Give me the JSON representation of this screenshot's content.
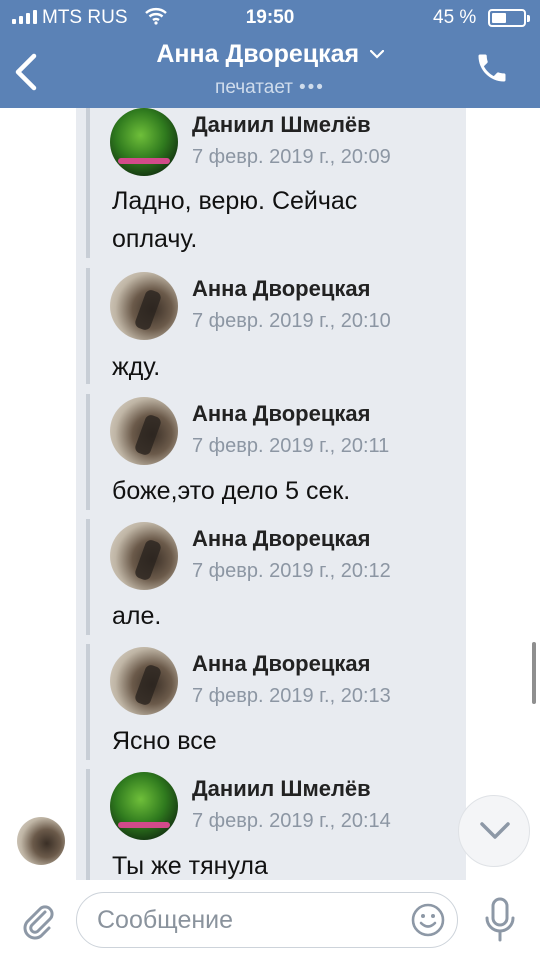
{
  "status_bar": {
    "carrier": "MTS RUS",
    "time": "19:50",
    "battery_percent": "45 %"
  },
  "header": {
    "contact_name": "Анна Дворецкая",
    "status_text": "печатает",
    "typing_dots": "•••"
  },
  "messages": [
    {
      "author": "Даниил Шмелёв",
      "avatar": "daniil",
      "date": "7 февр. 2019 г., 20:09",
      "lines": [
        "Ладно, верю. Сейчас",
        "оплачу."
      ]
    },
    {
      "author": "Анна Дворецкая",
      "avatar": "anna",
      "date": "7 февр. 2019 г., 20:10",
      "lines": [
        "жду."
      ]
    },
    {
      "author": "Анна Дворецкая",
      "avatar": "anna",
      "date": "7 февр. 2019 г., 20:11",
      "lines": [
        "боже,это дело 5 сек."
      ]
    },
    {
      "author": "Анна Дворецкая",
      "avatar": "anna",
      "date": "7 февр. 2019 г., 20:12",
      "lines": [
        "але."
      ]
    },
    {
      "author": "Анна Дворецкая",
      "avatar": "anna",
      "date": "7 февр. 2019 г., 20:13",
      "lines": [
        "Ясно все"
      ]
    },
    {
      "author": "Даниил Шмелёв",
      "avatar": "daniil",
      "date": "7 февр. 2019 г., 20:14",
      "lines": [
        "Ты же тянула"
      ]
    }
  ],
  "composer": {
    "placeholder": "Сообщение"
  },
  "icons": {
    "back": "chevron-left-icon",
    "call": "phone-icon",
    "attach": "paperclip-icon",
    "emoji": "smile-icon",
    "voice": "microphone-icon",
    "scroll": "chevron-down-icon"
  },
  "colors": {
    "header_bg": "#5b82b6",
    "bubble_bg": "#e8ebf0",
    "date_text": "#8c96a3",
    "quote_bar": "#c8ced6"
  }
}
